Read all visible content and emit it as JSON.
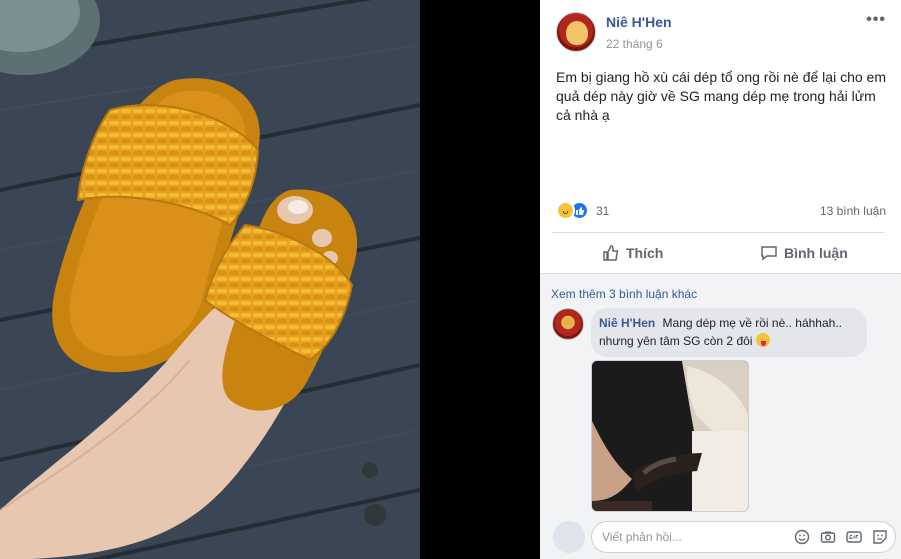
{
  "post": {
    "author": "Niê H'Hen",
    "date": "22 tháng 6",
    "text": "Em bị giang hồ xù cái dép tổ ong rồi nè để lại cho em quả dép này giờ về SG mang dép mẹ trong hải lửm cả nhà ạ",
    "reaction_count": "31",
    "comment_count": "13 bình luận"
  },
  "actions": {
    "like_label": "Thích",
    "comment_label": "Bình luận"
  },
  "comments": {
    "view_more": "Xem thêm 3 bình luận khác",
    "items": [
      {
        "author": "Niê H'Hen",
        "text": "Mang dép mẹ về rồi nè.. háhhah.. nhưng yên tâm SG còn 2 đôi"
      }
    ]
  },
  "reply": {
    "placeholder": "Viết phản hồi..."
  },
  "icons": {
    "reactions": [
      "haha-icon",
      "like-icon"
    ],
    "reply_tools": [
      "emoji-icon",
      "camera-icon",
      "gif-icon",
      "sticker-icon"
    ]
  }
}
